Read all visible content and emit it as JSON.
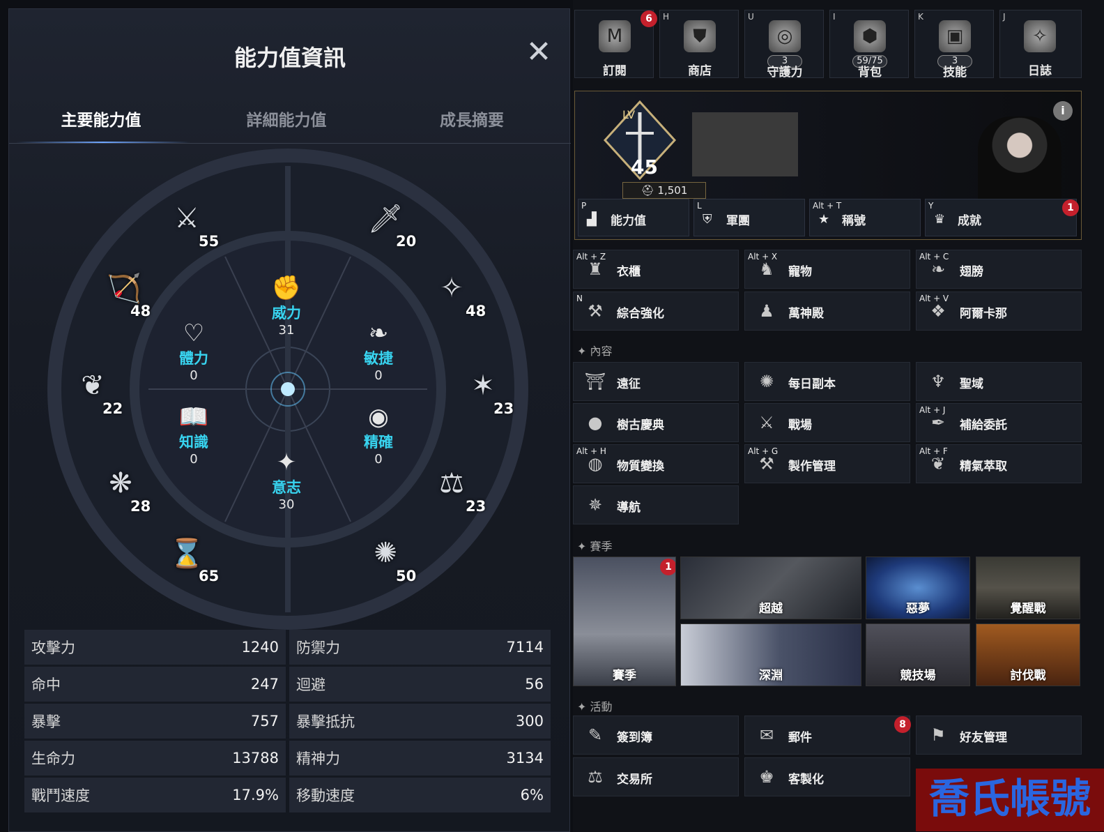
{
  "left_panel": {
    "title": "能力值資訊",
    "tabs": [
      "主要能力值",
      "詳細能力值",
      "成長摘要"
    ],
    "outer_values": [
      "55",
      "20",
      "48",
      "48",
      "22",
      "23",
      "28",
      "23",
      "65",
      "50"
    ],
    "core": {
      "power": {
        "label": "威力",
        "value": "31"
      },
      "vitality": {
        "label": "體力",
        "value": "0"
      },
      "agility": {
        "label": "敏捷",
        "value": "0"
      },
      "knowledge": {
        "label": "知識",
        "value": "0"
      },
      "accuracy": {
        "label": "精確",
        "value": "0"
      },
      "will": {
        "label": "意志",
        "value": "30"
      }
    },
    "stats": [
      [
        {
          "label": "攻擊力",
          "value": "1240"
        },
        {
          "label": "防禦力",
          "value": "7114"
        }
      ],
      [
        {
          "label": "命中",
          "value": "247"
        },
        {
          "label": "迴避",
          "value": "56"
        }
      ],
      [
        {
          "label": "暴擊",
          "value": "757"
        },
        {
          "label": "暴擊抵抗",
          "value": "300"
        }
      ],
      [
        {
          "label": "生命力",
          "value": "13788"
        },
        {
          "label": "精神力",
          "value": "3134"
        }
      ],
      [
        {
          "label": "戰鬥速度",
          "value": "17.9%"
        },
        {
          "label": "移動速度",
          "value": "6%"
        }
      ]
    ]
  },
  "top_bar": [
    {
      "hotkey": "",
      "label": "訂閱",
      "badge": "6",
      "count": ""
    },
    {
      "hotkey": "H",
      "label": "商店",
      "badge": "",
      "count": ""
    },
    {
      "hotkey": "U",
      "label": "守護力",
      "badge": "",
      "count": "3"
    },
    {
      "hotkey": "I",
      "label": "背包",
      "badge": "",
      "count": "59/75"
    },
    {
      "hotkey": "K",
      "label": "技能",
      "badge": "",
      "count": "3"
    },
    {
      "hotkey": "J",
      "label": "日誌",
      "badge": "",
      "count": ""
    }
  ],
  "profile": {
    "lv_tag": "LV",
    "level": "45",
    "power": "1,501",
    "buttons": [
      {
        "hotkey": "P",
        "label": "能力值"
      },
      {
        "hotkey": "L",
        "label": "軍團"
      },
      {
        "hotkey": "Alt + T",
        "label": "稱號"
      },
      {
        "hotkey": "Y",
        "label": "成就",
        "badge": "1"
      }
    ]
  },
  "menu_top": [
    {
      "hotkey": "Alt + Z",
      "label": "衣櫃"
    },
    {
      "hotkey": "Alt + X",
      "label": "寵物"
    },
    {
      "hotkey": "Alt + C",
      "label": "翅膀"
    },
    {
      "hotkey": "N",
      "label": "綜合強化"
    },
    {
      "hotkey": "",
      "label": "萬神殿"
    },
    {
      "hotkey": "Alt + V",
      "label": "阿爾卡那"
    }
  ],
  "section_content": "內容",
  "menu_content": [
    {
      "hotkey": "",
      "label": "遠征"
    },
    {
      "hotkey": "",
      "label": "每日副本"
    },
    {
      "hotkey": "",
      "label": "聖域"
    },
    {
      "hotkey": "",
      "label": "樹古慶典"
    },
    {
      "hotkey": "",
      "label": "戰場"
    },
    {
      "hotkey": "Alt + J",
      "label": "補給委託"
    },
    {
      "hotkey": "Alt + H",
      "label": "物質變換"
    },
    {
      "hotkey": "Alt + G",
      "label": "製作管理"
    },
    {
      "hotkey": "Alt + F",
      "label": "精氣萃取"
    },
    {
      "hotkey": "",
      "label": "導航"
    }
  ],
  "section_season": "賽季",
  "season_tiles": [
    {
      "label": "賽季",
      "badge": "1"
    },
    {
      "label": "超越"
    },
    {
      "label": "惡夢"
    },
    {
      "label": "覺醒戰"
    },
    {
      "label": "深淵"
    },
    {
      "label": "競技場"
    },
    {
      "label": "討伐戰"
    }
  ],
  "section_activity": "活動",
  "menu_activity": [
    {
      "label": "簽到簿"
    },
    {
      "label": "郵件",
      "badge": "8"
    },
    {
      "label": "好友管理"
    },
    {
      "label": "交易所"
    },
    {
      "label": "客製化"
    }
  ],
  "watermark": "喬氏帳號"
}
